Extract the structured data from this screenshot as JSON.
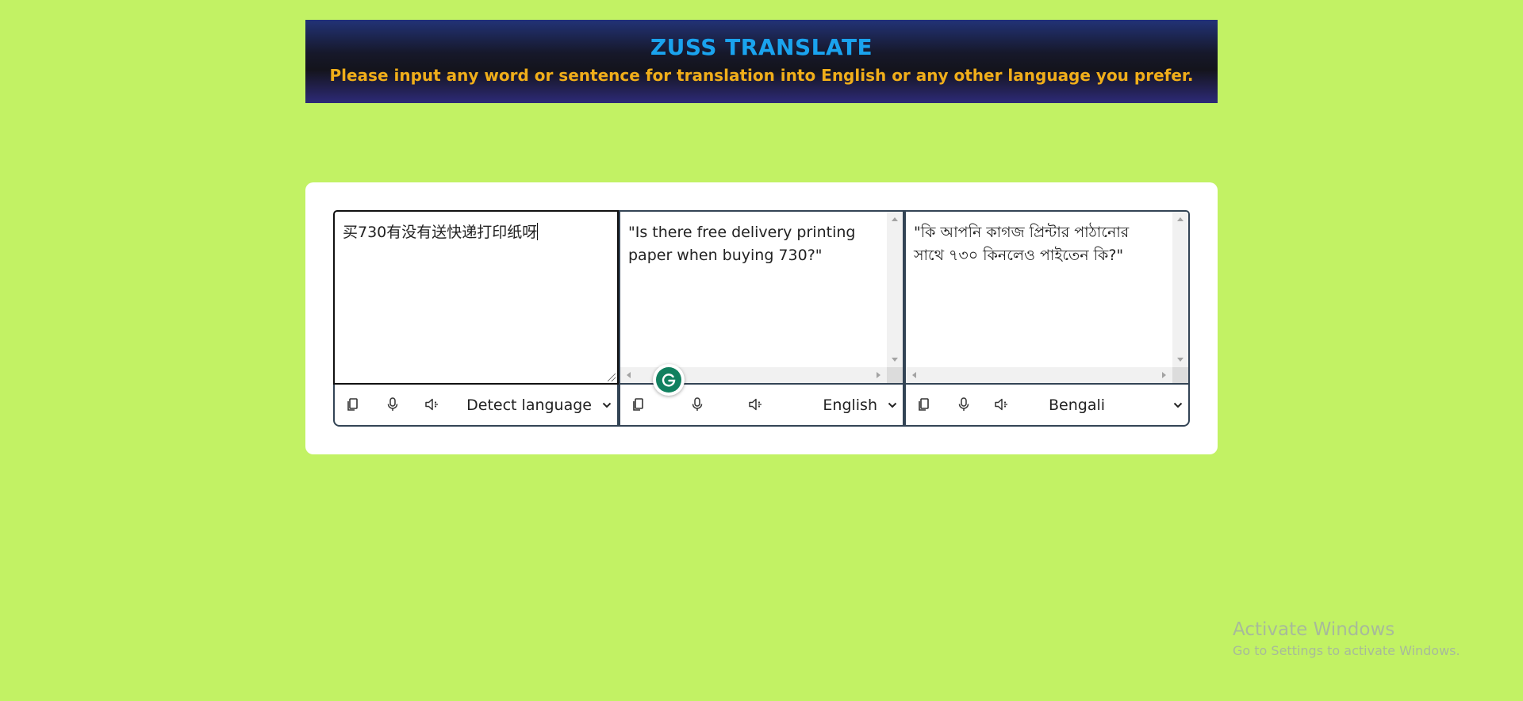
{
  "header": {
    "title": "ZUSS TRANSLATE",
    "subtitle": "Please input any word or sentence for translation into English or any other language you prefer."
  },
  "colors": {
    "page_background": "#c2f264",
    "title": "#1aa3ee",
    "subtitle": "#f0ae1a",
    "pane_border": "#334455",
    "grammarly": "#11805f"
  },
  "panes": [
    {
      "text": "买730有没有送快递打印纸呀",
      "language": "Detect language",
      "icons": [
        "copy-icon",
        "microphone-icon",
        "speaker-icon"
      ]
    },
    {
      "text": "\"Is there free delivery printing paper when buying 730?\"",
      "language": "English",
      "icons": [
        "copy-icon",
        "microphone-icon",
        "speaker-icon"
      ]
    },
    {
      "text": "\"কি আপনি কাগজ প্রিন্টার পাঠানোর সাথে ৭৩০ কিনলেও পাইতেন কি?\"",
      "language": "Bengali",
      "icons": [
        "copy-icon",
        "microphone-icon",
        "speaker-icon"
      ]
    }
  ],
  "overlay": {
    "grammarly_icon": "grammarly-icon",
    "windows_watermark_title": "Activate Windows",
    "windows_watermark_subtitle": "Go to Settings to activate Windows."
  }
}
